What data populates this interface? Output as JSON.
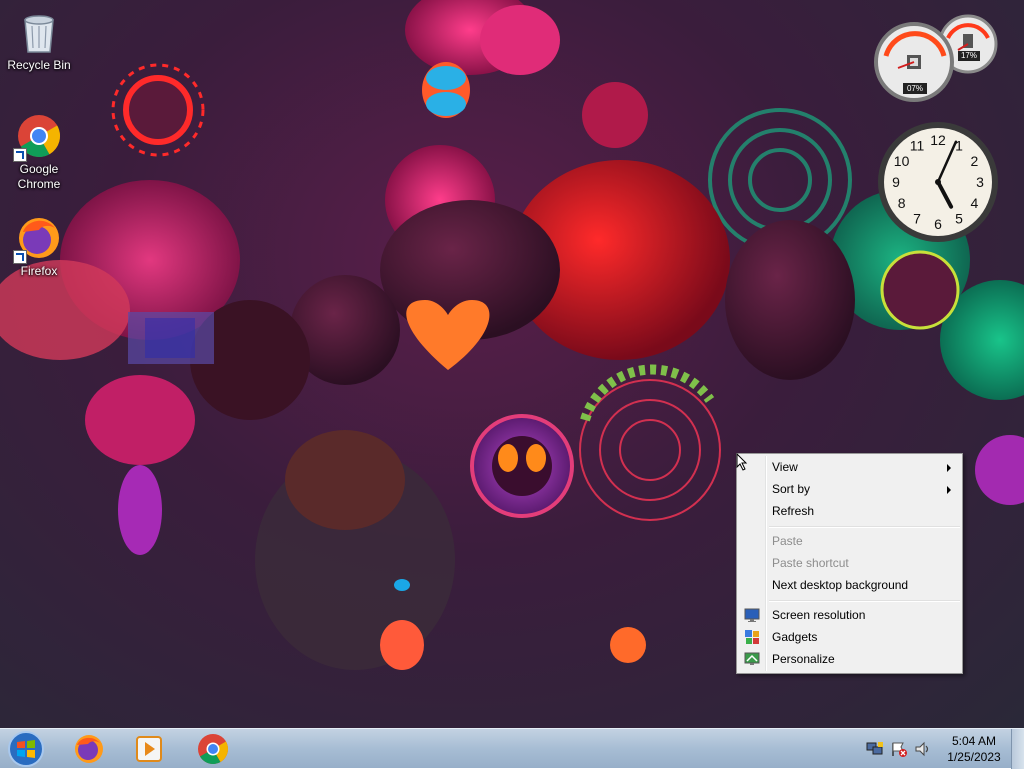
{
  "desktop_icons": [
    {
      "label": "Recycle Bin",
      "icon": "recycle-bin-icon",
      "shortcut": false
    },
    {
      "label": "Google Chrome",
      "icon": "chrome-icon",
      "shortcut": true
    },
    {
      "label": "Firefox",
      "icon": "firefox-icon",
      "shortcut": true
    }
  ],
  "gadgets": {
    "cpu_meter": {
      "cpu": "07%",
      "memory": "17%"
    },
    "clock": {
      "hour": 5,
      "minute": 4
    }
  },
  "context_menu": {
    "view": "View",
    "sort_by": "Sort by",
    "refresh": "Refresh",
    "paste": "Paste",
    "paste_shortcut": "Paste shortcut",
    "next_background": "Next desktop background",
    "screen_resolution": "Screen resolution",
    "gadgets": "Gadgets",
    "personalize": "Personalize"
  },
  "taskbar": {
    "pinned": [
      {
        "name": "firefox",
        "icon": "firefox-icon"
      },
      {
        "name": "media-player",
        "icon": "media-player-icon"
      },
      {
        "name": "chrome",
        "icon": "chrome-icon"
      }
    ],
    "tray_icons": [
      "network-icon",
      "action-center-flag-icon",
      "speaker-icon"
    ],
    "time": "5:04 AM",
    "date": "1/25/2023"
  },
  "colors": {
    "accent_red": "#d21e1e",
    "wallpaper_bg": "#2a2838",
    "taskbar": "#a7bdd4"
  }
}
